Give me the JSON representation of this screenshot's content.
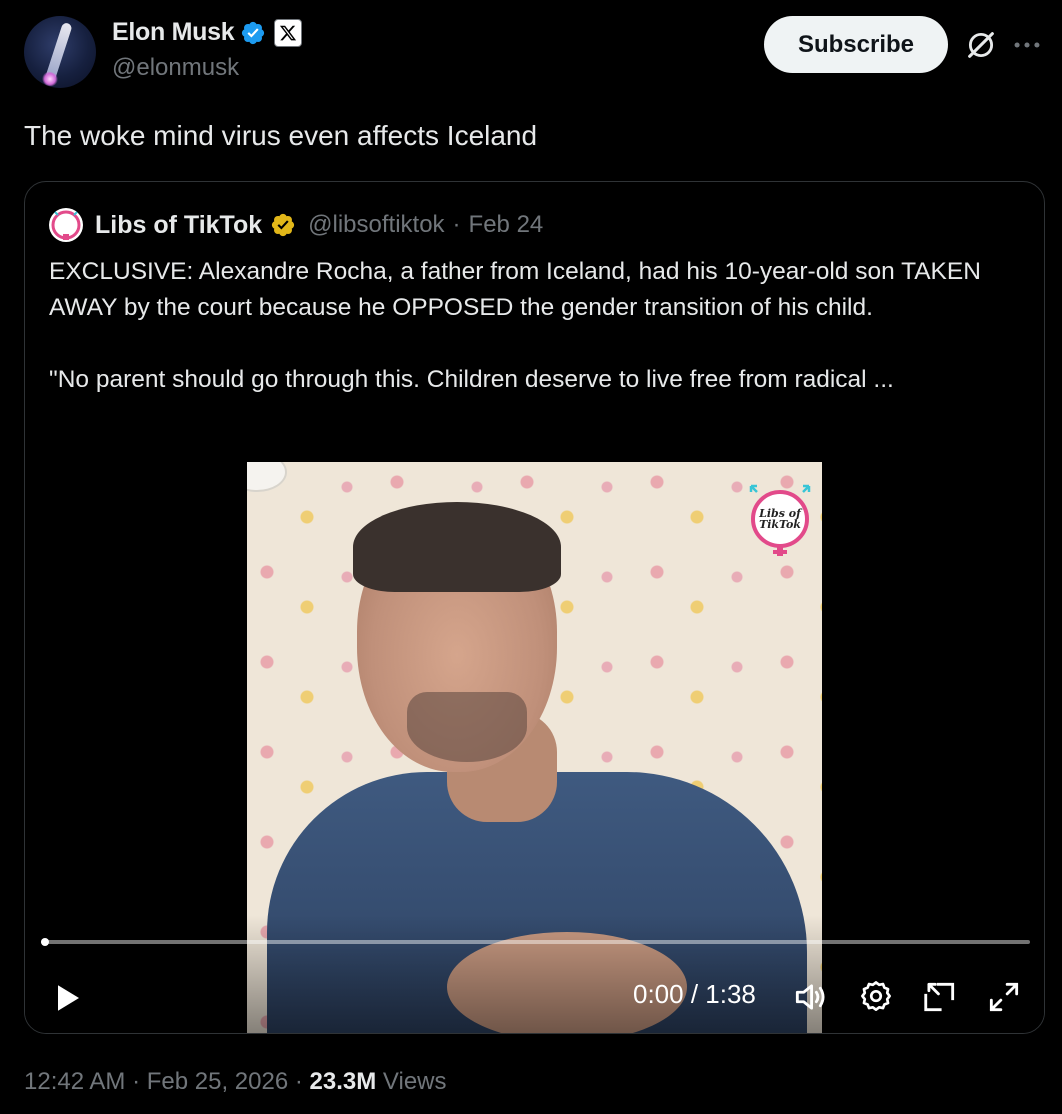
{
  "author": {
    "name": "Elon Musk",
    "handle": "@elonmusk",
    "affiliate_label": "X"
  },
  "actions": {
    "subscribe_label": "Subscribe",
    "grok_icon": "grok-icon",
    "more_icon": "more-icon"
  },
  "tweet": {
    "text": "The woke mind virus even affects Iceland"
  },
  "quoted": {
    "avatar_text": "Libs of TikTok",
    "name": "Libs of TikTok",
    "handle": "@libsoftiktok",
    "separator": "·",
    "date": "Feb 24",
    "paragraph1": "EXCLUSIVE: Alexandre Rocha, a father from Iceland, had his 10-year-old son TAKEN AWAY by the court because he OPPOSED the gender transition of his child.",
    "paragraph2": "\"No parent should go through this. Children deserve to live free from radical ...",
    "video": {
      "watermark_line1": "Libs of",
      "watermark_line2": "TikTok",
      "timecode": "0:00 / 1:38",
      "progress_fraction": 0.0
    }
  },
  "meta": {
    "time": "12:42 AM",
    "sep1": "·",
    "date": "Feb 25, 2026",
    "sep2": "·",
    "views_count": "23.3M",
    "views_label": "Views"
  },
  "colors": {
    "background": "#000000",
    "text": "#e7e9ea",
    "secondary": "#71767b",
    "verified_blue": "#1d9bf0",
    "verified_gold": "#e2b719",
    "border": "#2f3336"
  }
}
